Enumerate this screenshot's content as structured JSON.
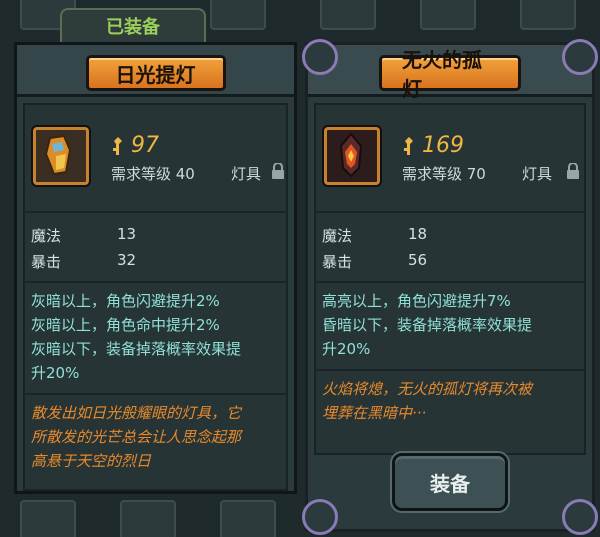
{
  "left_card": {
    "equipped_tab": "已装备",
    "title": "日光提灯",
    "price": "97",
    "requirement": "需求等级 40",
    "category": "灯具",
    "stats": [
      {
        "label": "魔法",
        "value": "13"
      },
      {
        "label": "暴击",
        "value": "32"
      }
    ],
    "effects": [
      "灰暗以上，角色闪避提升2%",
      "灰暗以上，角色命中提升2%",
      "灰暗以下，装备掉落概率效果提",
      "升20%"
    ],
    "lore": [
      "散发出如日光般耀眼的灯具，它",
      "所散发的光芒总会让人思念起那",
      "高悬于天空的烈日"
    ]
  },
  "right_card": {
    "title": "无火的孤灯",
    "price": "169",
    "requirement": "需求等级 70",
    "category": "灯具",
    "stats": [
      {
        "label": "魔法",
        "value": "18"
      },
      {
        "label": "暴击",
        "value": "56"
      }
    ],
    "effects": [
      "高亮以上，角色闪避提升7%",
      "昏暗以下，装备掉落概率效果提",
      "升20%"
    ],
    "lore": [
      "火焰将熄，无火的孤灯将再次被",
      "埋葬在黑暗中···"
    ],
    "equip_button": "装备"
  },
  "colors": {
    "title_plaque": "#e48a2c",
    "effect_text": "#8fe0d6",
    "lore_text": "#e88a2c",
    "price_text": "#f0b642",
    "equipped_text": "#9ccf5a"
  },
  "icons": {
    "price": "soul-key-icon",
    "lock": "lock-icon",
    "left_item": "sun-lantern-icon",
    "right_item": "flameless-lantern-icon"
  }
}
